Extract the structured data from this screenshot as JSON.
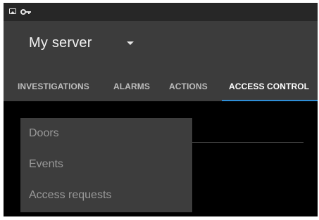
{
  "server": {
    "name": "My server"
  },
  "tabs": [
    {
      "label": "INVESTIGATIONS",
      "active": false
    },
    {
      "label": "ALARMS",
      "active": false
    },
    {
      "label": "ACTIONS",
      "active": false
    },
    {
      "label": "ACCESS CONTROL",
      "active": true
    }
  ],
  "menu": {
    "items": [
      {
        "label": "Doors"
      },
      {
        "label": "Events"
      },
      {
        "label": "Access requests"
      }
    ]
  },
  "colors": {
    "app_bar": "#3c3c3c",
    "status_bar": "#272727",
    "background": "#000000",
    "accent": "#2f8fd8",
    "menu_bg": "#3d3d3d"
  },
  "icons": {
    "status": [
      "image-icon",
      "key-icon"
    ],
    "server_dropdown": "caret-down-icon"
  }
}
